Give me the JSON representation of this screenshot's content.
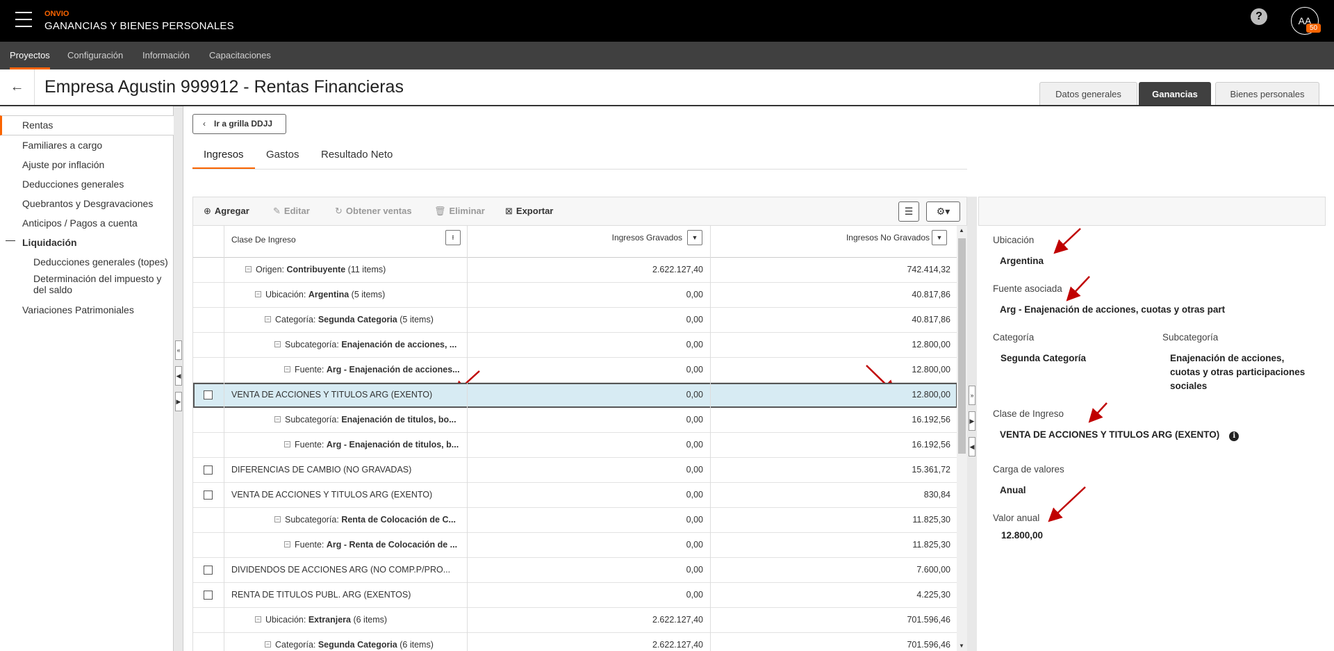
{
  "header": {
    "brand_small": "ONVIO",
    "brand_title": "GANANCIAS Y BIENES PERSONALES",
    "help_icon": "question-circle-icon",
    "avatar_initials": "AA",
    "avatar_badge": "50"
  },
  "nav": {
    "items": [
      "Proyectos",
      "Configuración",
      "Información",
      "Capacitaciones"
    ],
    "active": "Proyectos"
  },
  "title_row": {
    "page_title": "Empresa Agustin 999912 - Rentas Financieras",
    "tabs": [
      "Datos generales",
      "Ganancias",
      "Bienes personales"
    ],
    "active_tab": "Ganancias"
  },
  "sidebar": {
    "items": [
      "Rentas",
      "Familiares a cargo",
      "Ajuste por inflación",
      "Deducciones generales",
      "Quebrantos y Desgravaciones",
      "Anticipos / Pagos a cuenta",
      "Liquidación",
      "Deducciones generales (topes)",
      "Determinación del impuesto y",
      "del saldo",
      "Variaciones Patrimoniales"
    ],
    "active": "Rentas"
  },
  "main": {
    "goto_label": "Ir a grilla DDJJ",
    "subtabs": [
      "Ingresos",
      "Gastos",
      "Resultado Neto"
    ],
    "active_subtab": "Ingresos",
    "toolbar": {
      "agregar": "Agregar",
      "editar": "Editar",
      "obtener_ventas": "Obtener ventas",
      "eliminar": "Eliminar",
      "exportar": "Exportar"
    }
  },
  "grid": {
    "columns": [
      "Clase De Ingreso",
      "Ingresos Gravados",
      "Ingresos No Gravados"
    ],
    "rows": [
      {
        "prefix": "Origen: ",
        "bold": "Contribuyente",
        "suffix": " (11 items)",
        "grav": "2.622.127,40",
        "nograv": "742.414,32"
      },
      {
        "prefix": "Ubicación: ",
        "bold": "Argentina",
        "suffix": " (5 items)",
        "grav": "0,00",
        "nograv": "40.817,86"
      },
      {
        "prefix": "Categoría: ",
        "bold": "Segunda Categoria",
        "suffix": " (5 items)",
        "grav": "0,00",
        "nograv": "40.817,86"
      },
      {
        "prefix": "Subcategoría: ",
        "bold": "Enajenación de acciones, ...",
        "suffix": "",
        "grav": "0,00",
        "nograv": "12.800,00"
      },
      {
        "prefix": "Fuente: ",
        "bold": "Arg - Enajenación de acciones...",
        "suffix": "",
        "grav": "0,00",
        "nograv": "12.800,00"
      },
      {
        "text": "VENTA DE ACCIONES Y TITULOS ARG (EXENTO)",
        "grav": "0,00",
        "nograv": "12.800,00"
      },
      {
        "prefix": "Subcategoría: ",
        "bold": "Enajenación de titulos, bo...",
        "suffix": "",
        "grav": "0,00",
        "nograv": "16.192,56"
      },
      {
        "prefix": "Fuente: ",
        "bold": "Arg - Enajenación de titulos, b...",
        "suffix": "",
        "grav": "0,00",
        "nograv": "16.192,56"
      },
      {
        "text": "DIFERENCIAS DE CAMBIO (NO GRAVADAS)",
        "grav": "0,00",
        "nograv": "15.361,72"
      },
      {
        "text": "VENTA DE ACCIONES Y TITULOS ARG (EXENTO)",
        "grav": "0,00",
        "nograv": "830,84"
      },
      {
        "prefix": "Subcategoría: ",
        "bold": "Renta de Colocación de C...",
        "suffix": "",
        "grav": "0,00",
        "nograv": "11.825,30"
      },
      {
        "prefix": "Fuente: ",
        "bold": "Arg - Renta de Colocación de ...",
        "suffix": "",
        "grav": "0,00",
        "nograv": "11.825,30"
      },
      {
        "text": "DIVIDENDOS DE ACCIONES ARG (NO COMP.P/PRO...",
        "grav": "0,00",
        "nograv": "7.600,00"
      },
      {
        "text": "RENTA DE TITULOS PUBL. ARG (EXENTOS)",
        "grav": "0,00",
        "nograv": "4.225,30"
      },
      {
        "prefix": "Ubicación: ",
        "bold": "Extranjera",
        "suffix": " (6 items)",
        "grav": "2.622.127,40",
        "nograv": "701.596,46"
      },
      {
        "prefix": "Categoría: ",
        "bold": "Segunda Categoria",
        "suffix": " (6 items)",
        "grav": "2.622.127,40",
        "nograv": "701.596,46"
      }
    ]
  },
  "detail": {
    "ubicacion_label": "Ubicación",
    "ubicacion_value": "Argentina",
    "fuente_label": "Fuente asociada",
    "fuente_value": "Arg - Enajenación de acciones, cuotas y otras part",
    "categoria_label": "Categoría",
    "categoria_value": "Segunda Categoría",
    "subcategoria_label": "Subcategoría",
    "subcategoria_value_1": "Enajenación de acciones,",
    "subcategoria_value_2": "cuotas y otras participaciones",
    "subcategoria_value_3": "sociales",
    "clase_label": "Clase de Ingreso",
    "clase_value": "VENTA DE ACCIONES Y TITULOS ARG (EXENTO)",
    "carga_label": "Carga de valores",
    "carga_value": "Anual",
    "valor_label": "Valor anual",
    "valor_value": "12.800,00"
  },
  "colors": {
    "accent": "#fa6400",
    "selected_row": "#d7ebf3",
    "annotation_arrow": "#c00000"
  }
}
